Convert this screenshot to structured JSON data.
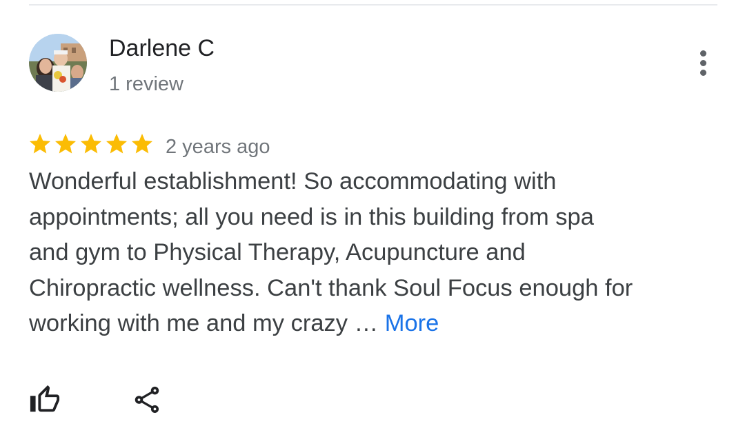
{
  "reviewer": {
    "name": "Darlene C",
    "review_count": "1 review",
    "avatar_icon": "profile-photo"
  },
  "menu_icon": "more-vert-icon",
  "review": {
    "rating": 5,
    "max_rating": 5,
    "star_color": "#fbbc04",
    "date": "2 years ago",
    "text_lines": [
      "Wonderful establishment! So accommodating with",
      "appointments; all you need is in this building from spa",
      "and gym to Physical Therapy, Acupuncture and",
      "Chiropractic wellness. Can't thank Soul Focus enough for",
      "working with me and my crazy … "
    ],
    "more_label": "More",
    "link_color": "#1a73e8"
  },
  "actions": [
    {
      "icon": "thumb-up-icon"
    },
    {
      "icon": "share-icon"
    }
  ]
}
